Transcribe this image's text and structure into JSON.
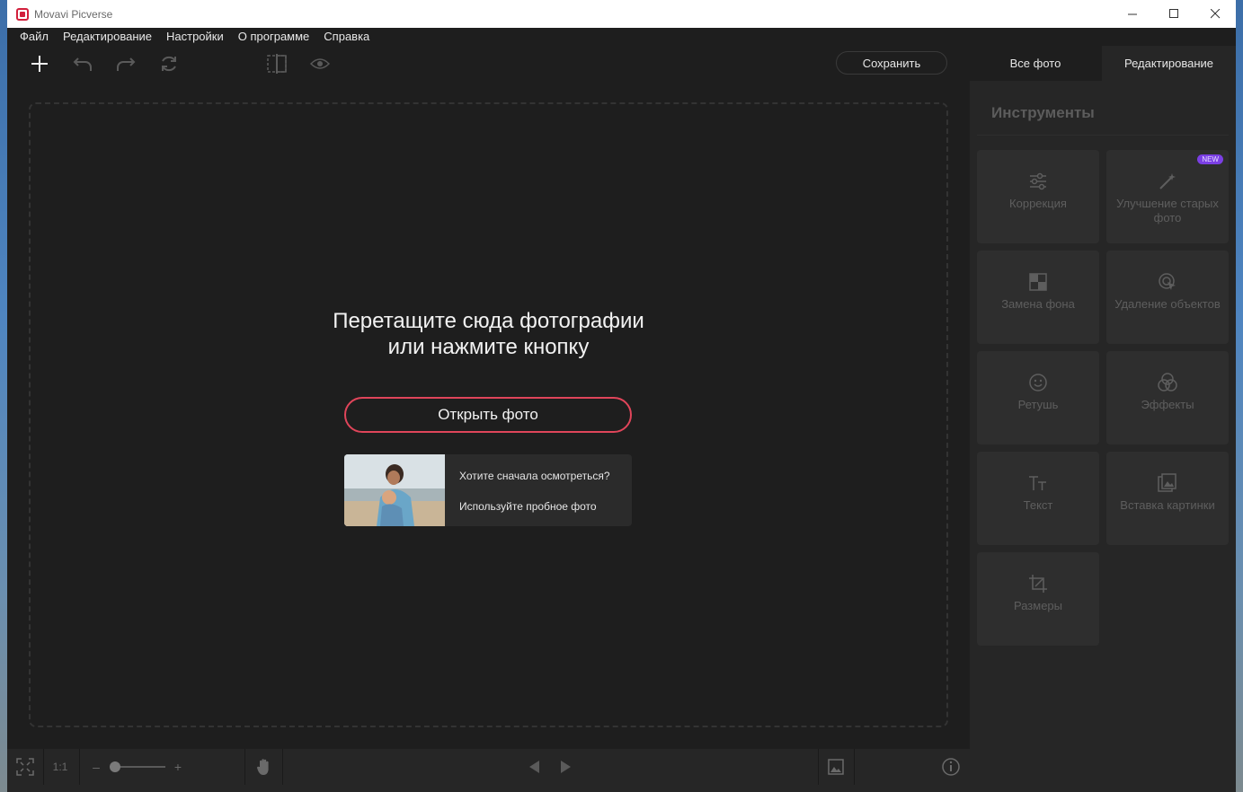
{
  "window": {
    "title": "Movavi Picverse"
  },
  "menu": [
    "Файл",
    "Редактирование",
    "Настройки",
    "О программе",
    "Справка"
  ],
  "toolbar": {
    "save_label": "Сохранить",
    "tabs": [
      {
        "label": "Все фото",
        "active": false
      },
      {
        "label": "Редактирование",
        "active": true
      }
    ]
  },
  "canvas": {
    "title_line1": "Перетащите сюда фотографии",
    "title_line2": "или нажмите кнопку",
    "open_button": "Открыть фото",
    "sample": {
      "line1": "Хотите сначала осмотреться?",
      "line2": "Используйте пробное фото"
    }
  },
  "bottom": {
    "ratio_label": "1:1"
  },
  "panel": {
    "title": "Инструменты",
    "tools": [
      {
        "label": "Коррекция",
        "icon": "sliders-icon"
      },
      {
        "label": "Улучшение старых фото",
        "icon": "magic-wand-icon",
        "badge": "NEW"
      },
      {
        "label": "Замена фона",
        "icon": "checker-icon"
      },
      {
        "label": "Удаление объектов",
        "icon": "cursor-eraser-icon"
      },
      {
        "label": "Ретушь",
        "icon": "smile-icon"
      },
      {
        "label": "Эффекты",
        "icon": "circles-icon"
      },
      {
        "label": "Текст",
        "icon": "text-icon"
      },
      {
        "label": "Вставка картинки",
        "icon": "image-insert-icon"
      },
      {
        "label": "Размеры",
        "icon": "crop-icon"
      }
    ]
  },
  "colors": {
    "accent": "#e0455a",
    "badge": "#7b3fe4",
    "background": "#1e1e1e",
    "panel": "#262626"
  }
}
